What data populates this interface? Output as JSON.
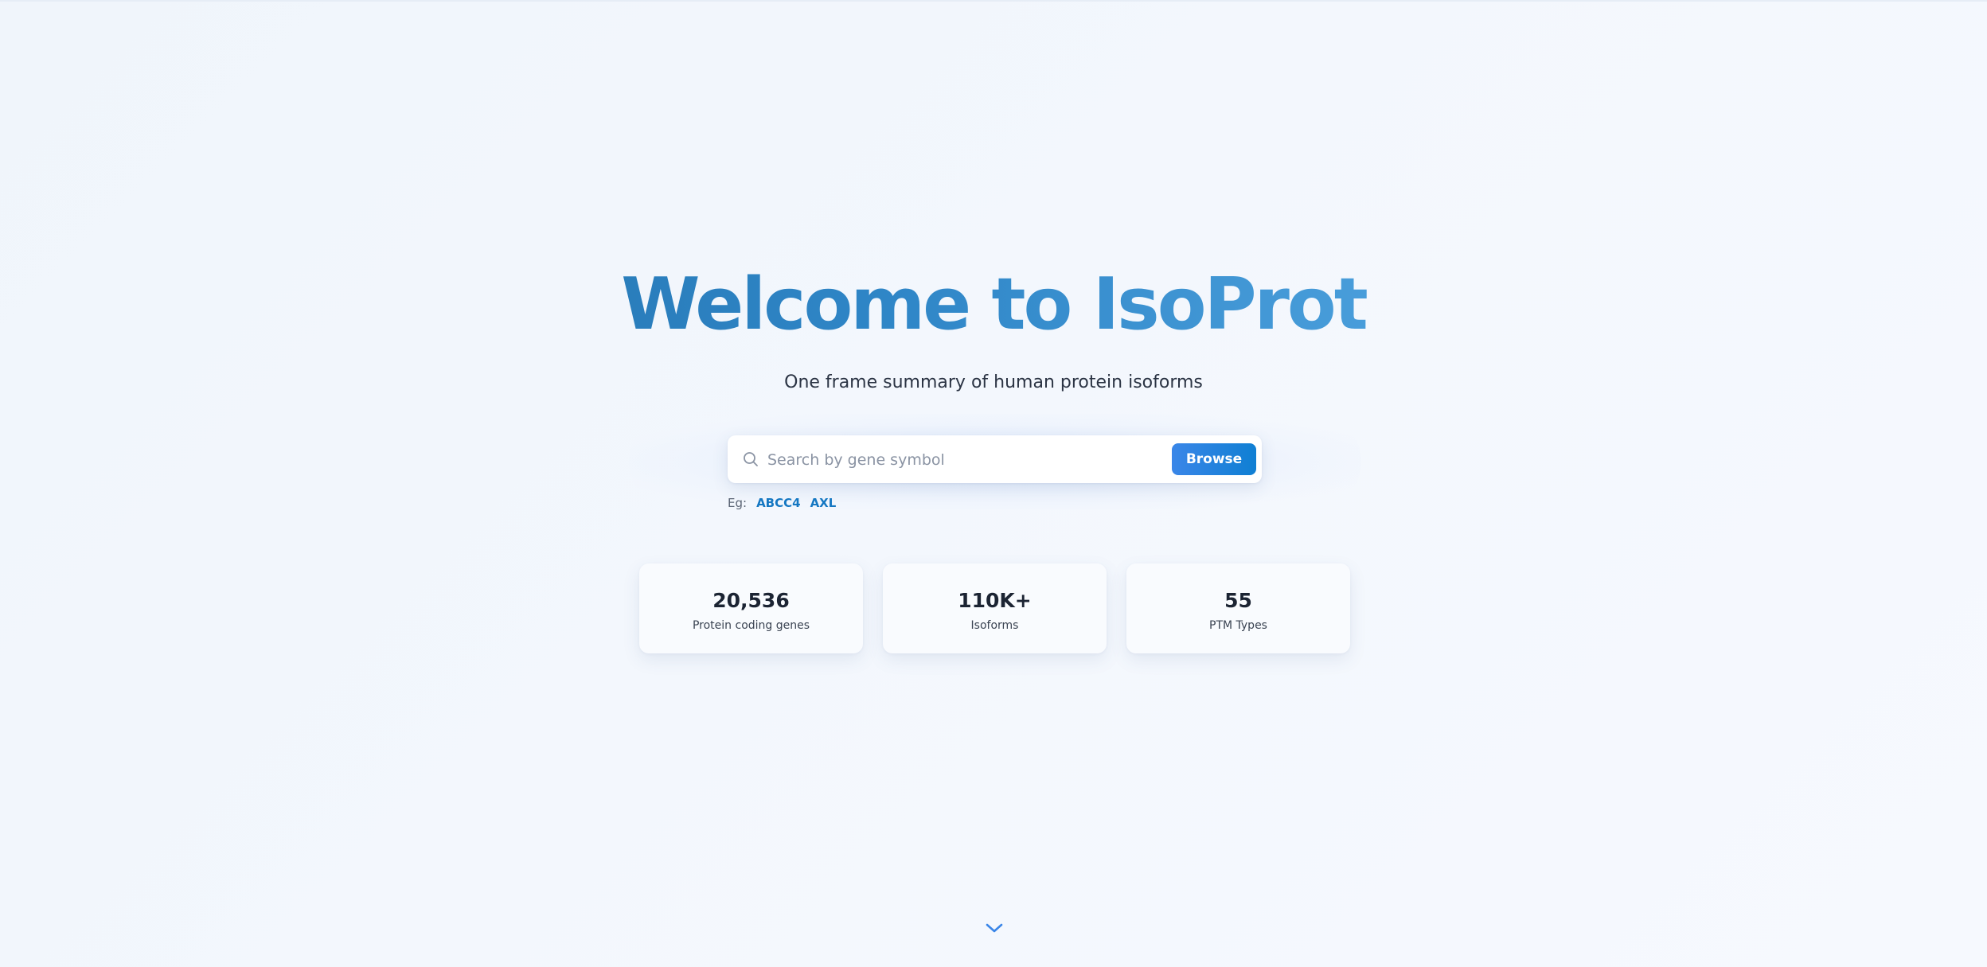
{
  "hero": {
    "title": "Welcome to IsoProt",
    "subtitle": "One frame summary of human protein isoforms"
  },
  "search": {
    "placeholder": "Search by gene symbol",
    "value": "",
    "icon": "search-icon",
    "button_label": "Browse",
    "examples_label": "Eg:",
    "examples": [
      "ABCC4",
      "AXL"
    ]
  },
  "stats": [
    {
      "value": "20,536",
      "label": "Protein coding genes"
    },
    {
      "value": "110K+",
      "label": "Isoforms"
    },
    {
      "value": "55",
      "label": "PTM Types"
    }
  ],
  "scroll": {
    "icon": "chevron-down-icon"
  },
  "colors": {
    "title_gradient_start": "#1f6aa3",
    "title_gradient_end": "#64b0e6",
    "button_start": "#3a86e8",
    "button_end": "#0f7fd3",
    "link": "#1477c2",
    "chevron": "#3a86e8"
  }
}
